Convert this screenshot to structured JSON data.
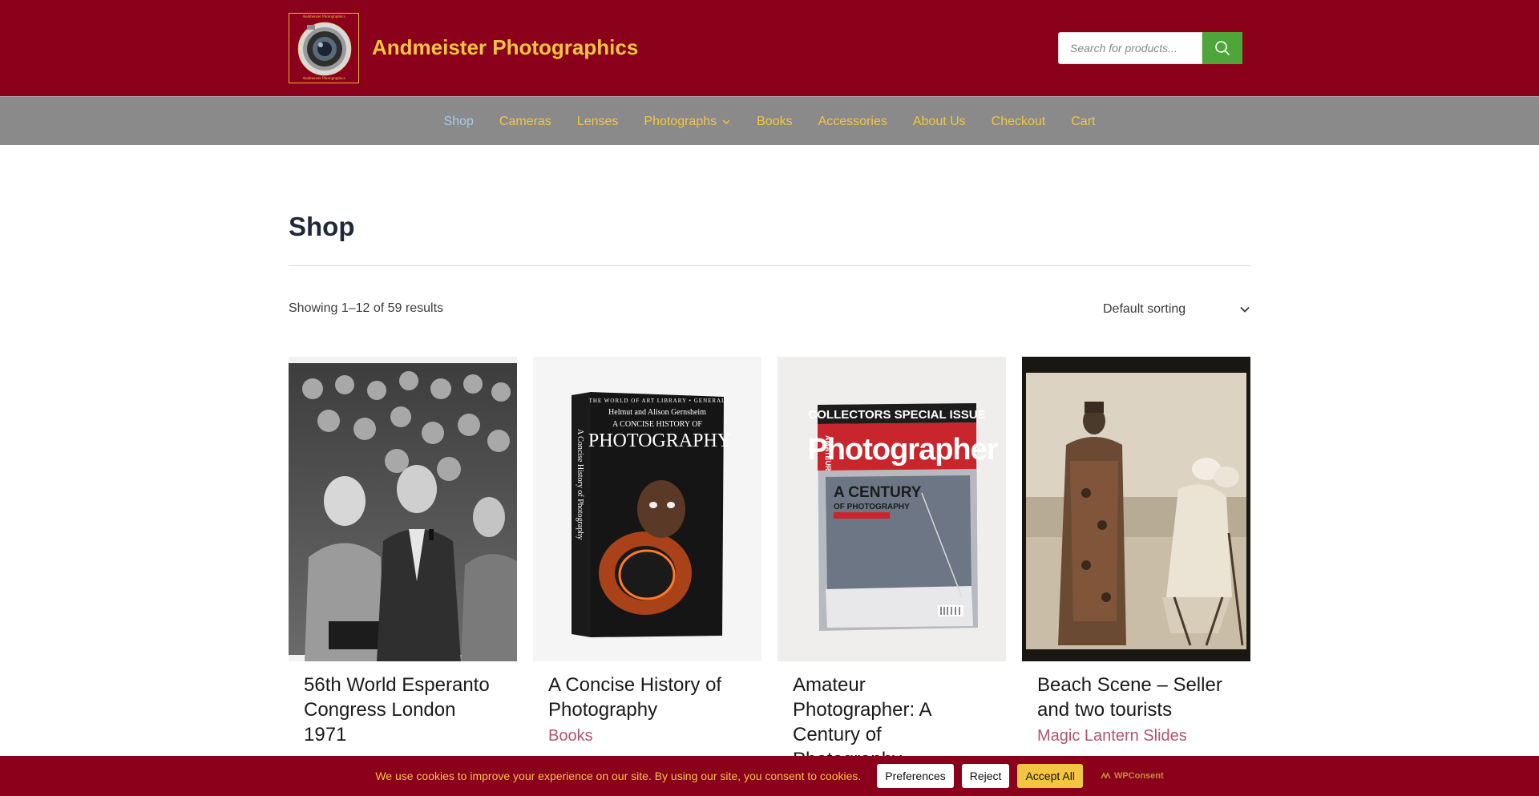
{
  "site": {
    "logo_top_text": "Andmeister Photographics",
    "logo_bottom_text": "Andmeister Photographics",
    "title": "Andmeister Photographics",
    "search_placeholder": "Search for products..."
  },
  "nav": {
    "items": [
      {
        "label": "Shop",
        "active": true
      },
      {
        "label": "Cameras"
      },
      {
        "label": "Lenses"
      },
      {
        "label": "Photographs",
        "has_dropdown": true
      },
      {
        "label": "Books"
      },
      {
        "label": "Accessories"
      },
      {
        "label": "About Us"
      },
      {
        "label": "Checkout"
      },
      {
        "label": "Cart"
      }
    ]
  },
  "page": {
    "title": "Shop",
    "result_count": "Showing 1–12 of 59 results",
    "sorting": "Default sorting"
  },
  "products": [
    {
      "title": "56th World Esperanto Congress London 1971",
      "category": ""
    },
    {
      "title": "A Concise History of Photography",
      "category": "Books"
    },
    {
      "title": "Amateur Photographer: A Century of Photography",
      "category": ""
    },
    {
      "title": "Beach Scene – Seller and two tourists",
      "category": "Magic Lantern Slides"
    }
  ],
  "book_cover": {
    "series": "THE WORLD OF ART LIBRARY • GENERAL",
    "authors": "Helmut and Alison Gernsheim",
    "subtitle": "A CONCISE HISTORY OF",
    "title": "PHOTOGRAPHY",
    "spine": "A Concise History of Photography"
  },
  "magazine_cover": {
    "banner": "COLLECTORS SPECIAL ISSUE",
    "masthead_small": "AMATEUR",
    "masthead": "Photographer",
    "headline": "A CENTURY",
    "subheadline": "OF PHOTOGRAPHY"
  },
  "cookie": {
    "text": "We use cookies to improve your experience on our site. By using our site, you consent to cookies.",
    "preferences": "Preferences",
    "reject": "Reject",
    "accept": "Accept All",
    "brand": "WPConsent"
  },
  "colors": {
    "header_bg": "#8b001b",
    "nav_bg": "#8a8a8a",
    "accent_gold": "#f4c542",
    "search_green": "#4ea63a",
    "category_pink": "#b3546b"
  }
}
